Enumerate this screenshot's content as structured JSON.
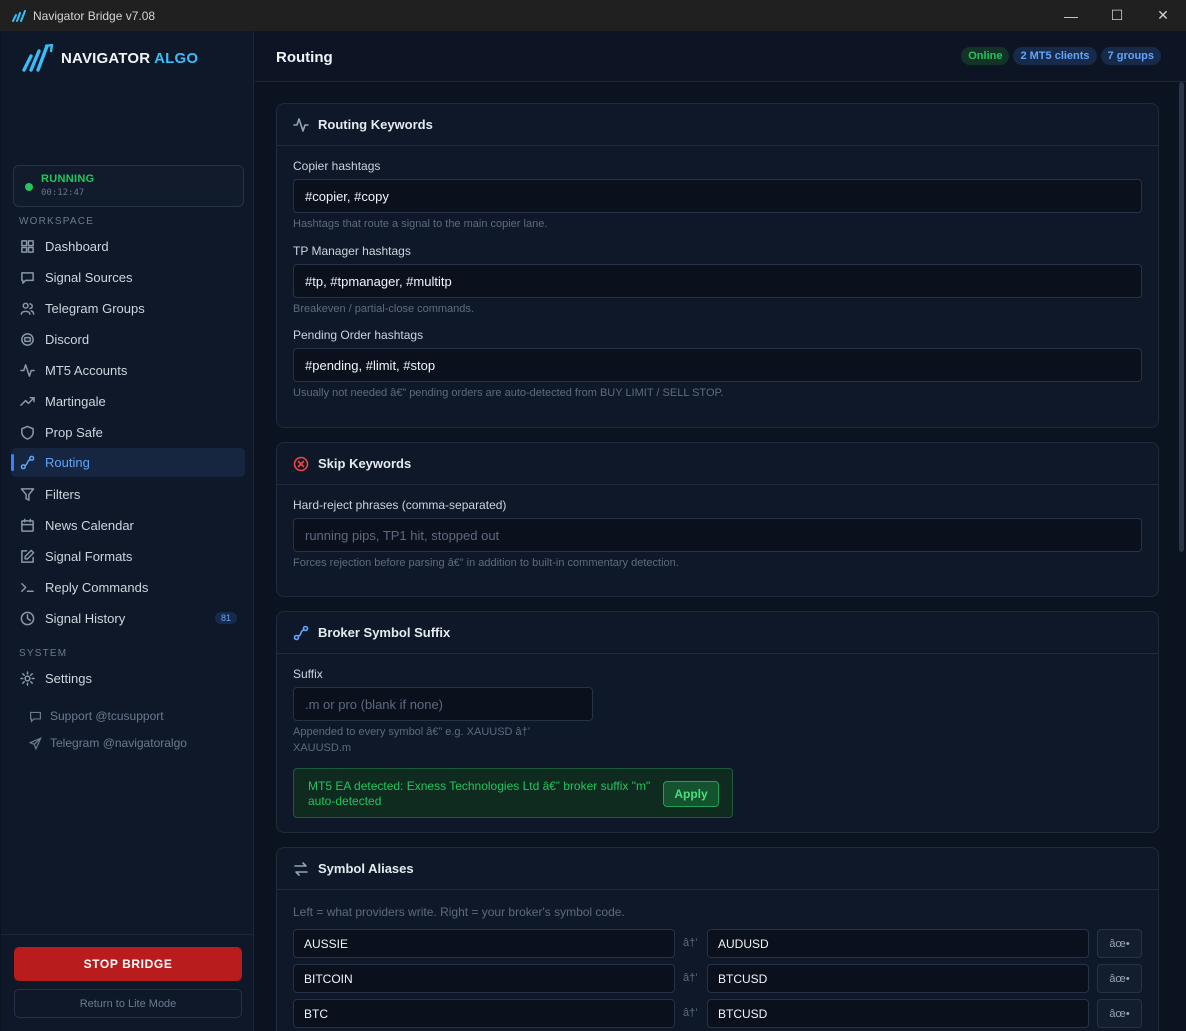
{
  "window": {
    "title": "Navigator Bridge v7.08",
    "minimize": "—",
    "maximize": "☐",
    "close": "✕"
  },
  "brand": {
    "name_main": "NAVIGATOR",
    "name_accent": " ALGO"
  },
  "status": {
    "label": "RUNNING",
    "uptime": "00:12:47"
  },
  "sidebar": {
    "workspace_label": "WORKSPACE",
    "system_label": "SYSTEM",
    "items": [
      {
        "label": "Dashboard",
        "icon": "grid-icon"
      },
      {
        "label": "Signal Sources",
        "icon": "message-icon"
      },
      {
        "label": "Telegram Groups",
        "icon": "users-icon"
      },
      {
        "label": "Discord",
        "icon": "discord-icon"
      },
      {
        "label": "MT5 Accounts",
        "icon": "pulse-icon"
      },
      {
        "label": "Martingale",
        "icon": "trending-icon"
      },
      {
        "label": "Prop Safe",
        "icon": "shield-icon"
      },
      {
        "label": "Routing",
        "icon": "route-icon",
        "active": true
      },
      {
        "label": "Filters",
        "icon": "filter-icon"
      },
      {
        "label": "News Calendar",
        "icon": "calendar-icon"
      },
      {
        "label": "Signal Formats",
        "icon": "edit-icon"
      },
      {
        "label": "Reply Commands",
        "icon": "terminal-icon"
      },
      {
        "label": "Signal History",
        "icon": "clock-icon",
        "badge": "81"
      }
    ],
    "settings": {
      "label": "Settings",
      "icon": "gear-icon"
    },
    "support": "Support @tcusupport",
    "telegram": "Telegram @navigatoralgo",
    "stop_button": "STOP BRIDGE",
    "lite_button": "Return to Lite Mode"
  },
  "header": {
    "title": "Routing",
    "pills": [
      "Online",
      "2 MT5 clients",
      "7 groups"
    ]
  },
  "routing_keywords": {
    "title": "Routing Keywords",
    "copier_label": "Copier hashtags",
    "copier_value": "#copier, #copy",
    "copier_hint": "Hashtags that route a signal to the main copier lane.",
    "tp_label": "TP Manager hashtags",
    "tp_value": "#tp, #tpmanager, #multitp",
    "tp_hint": "Breakeven / partial-close commands.",
    "pending_label": "Pending Order hashtags",
    "pending_value": "#pending, #limit, #stop",
    "pending_hint": "Usually not needed â€” pending orders are auto-detected from BUY LIMIT / SELL STOP."
  },
  "skip_keywords": {
    "title": "Skip Keywords",
    "label": "Hard-reject phrases (comma-separated)",
    "placeholder": "running pips, TP1 hit, stopped out",
    "hint": "Forces rejection before parsing â€” in addition to built-in commentary detection."
  },
  "broker_suffix": {
    "title": "Broker Symbol Suffix",
    "label": "Suffix",
    "placeholder": ".m  or  pro  (blank if none)",
    "hint_line1": "Appended to every symbol â€” e.g. XAUUSD â†’",
    "hint_line2": "XAUUSD.m",
    "detected": "MT5 EA detected: Exness Technologies Ltd â€” broker suffix \"m\" auto-detected",
    "apply": "Apply"
  },
  "symbol_aliases": {
    "title": "Symbol Aliases",
    "hint": "Left = what providers write. Right = your broker's symbol code.",
    "arrow": "â†’",
    "delete": "âœ•",
    "rows": [
      {
        "from": "AUSSIE",
        "to": "AUDUSD"
      },
      {
        "from": "BITCOIN",
        "to": "BTCUSD"
      },
      {
        "from": "BTC",
        "to": "BTCUSD"
      }
    ]
  }
}
